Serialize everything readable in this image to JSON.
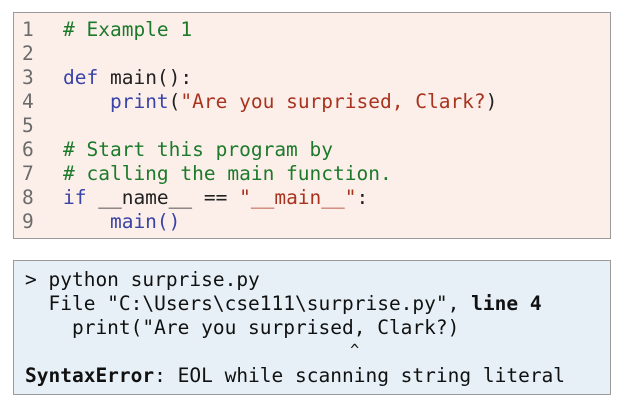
{
  "editor": {
    "lines": [
      {
        "num": "1",
        "parts": [
          {
            "t": "# Example 1",
            "c": "cm"
          }
        ]
      },
      {
        "num": "2",
        "parts": []
      },
      {
        "num": "3",
        "parts": [
          {
            "t": "def",
            "c": "kw"
          },
          {
            "t": " main():",
            "c": "tx"
          }
        ]
      },
      {
        "num": "4",
        "parts": [
          {
            "t": "    ",
            "c": "tx"
          },
          {
            "t": "print",
            "c": "kw"
          },
          {
            "t": "(",
            "c": "tx"
          },
          {
            "t": "\"Are you surprised, Clark?",
            "c": "st"
          },
          {
            "t": ")",
            "c": "tx"
          }
        ]
      },
      {
        "num": "5",
        "parts": []
      },
      {
        "num": "6",
        "parts": [
          {
            "t": "# Start this program by",
            "c": "cm"
          }
        ]
      },
      {
        "num": "7",
        "parts": [
          {
            "t": "# calling the main function.",
            "c": "cm"
          }
        ]
      },
      {
        "num": "8",
        "parts": [
          {
            "t": "if",
            "c": "kw"
          },
          {
            "t": " __name__ == ",
            "c": "tx"
          },
          {
            "t": "\"__main__\"",
            "c": "st"
          },
          {
            "t": ":",
            "c": "tx"
          }
        ]
      },
      {
        "num": "9",
        "parts": [
          {
            "t": "    main()",
            "c": "kw"
          }
        ]
      }
    ]
  },
  "terminal": {
    "command": "> python surprise.py",
    "file_prefix": "  File \"C:\\Users\\cse111\\surprise.py\", ",
    "file_line": "line 4",
    "source_echo": "    print(\"Are you surprised, Clark?)",
    "caret": "                                    ^",
    "error_type": "SyntaxError",
    "error_message": ": EOL while scanning string literal"
  }
}
